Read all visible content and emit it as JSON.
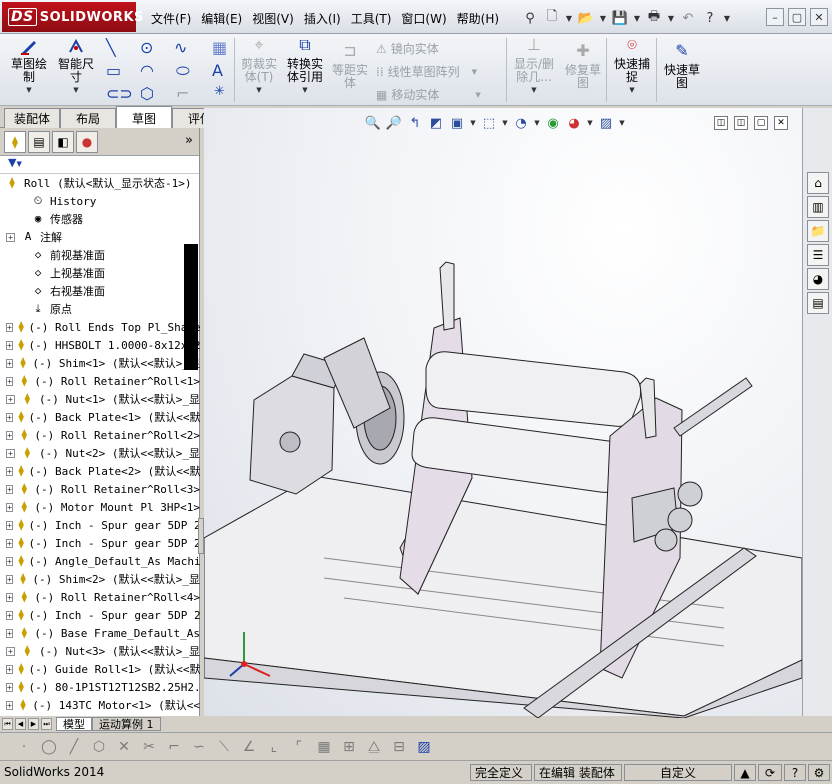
{
  "app": {
    "logo_prefix": "DS",
    "logo_text": "SOLIDWORKS"
  },
  "menu": [
    "文件(F)",
    "编辑(E)",
    "视图(V)",
    "插入(I)",
    "工具(T)",
    "窗口(W)",
    "帮助(H)"
  ],
  "ribbon": {
    "sketch": "草图绘\n制",
    "smart_dim": "智能尺\n寸",
    "trim": "剪裁实\n体(T)",
    "convert": "转换实\n体引用",
    "offset": "等距实\n体",
    "mirror": "镜向实体",
    "linear_pattern": "线性草图阵列",
    "move": "移动实体",
    "show_delete": "显示/删\n除几...",
    "repair": "修复草\n图",
    "quick_snap": "快速捕\n捉",
    "rapid_sketch": "快速草\n图"
  },
  "tabs": [
    "装配体",
    "布局",
    "草图",
    "评估"
  ],
  "active_tab": "草图",
  "tree": {
    "root": "Roll  (默认<默认_显示状态-1>)",
    "items": [
      {
        "label": "History",
        "icon": "history-icon",
        "expand": false
      },
      {
        "label": "传感器",
        "icon": "sensor-icon",
        "expand": false
      },
      {
        "label": "注解",
        "icon": "annotation-icon",
        "expand": true
      },
      {
        "label": "前视基准面",
        "icon": "plane-icon",
        "expand": false
      },
      {
        "label": "上视基准面",
        "icon": "plane-icon",
        "expand": false
      },
      {
        "label": "右视基准面",
        "icon": "plane-icon",
        "expand": false
      },
      {
        "label": "原点",
        "icon": "origin-icon",
        "expand": false
      },
      {
        "label": "(-) Roll Ends Top Pl_Shape",
        "icon": "part-icon",
        "expand": true
      },
      {
        "label": "(-) HHSBOLT 1.0000-8x12x12",
        "icon": "part-icon",
        "expand": true
      },
      {
        "label": "(-) Shim<1> (默认<<默认>_显",
        "icon": "part-icon",
        "expand": true
      },
      {
        "label": "(-) Roll Retainer^Roll<1>",
        "icon": "part-icon",
        "expand": true
      },
      {
        "label": "(-) Nut<1> (默认<<默认>_显",
        "icon": "part-icon",
        "expand": true
      },
      {
        "label": "(-) Back Plate<1> (默认<<默",
        "icon": "part-icon",
        "expand": true
      },
      {
        "label": "(-) Roll Retainer^Roll<2>",
        "icon": "part-icon",
        "expand": true
      },
      {
        "label": "(-) Nut<2> (默认<<默认>_显",
        "icon": "part-icon",
        "expand": true
      },
      {
        "label": "(-) Back Plate<2> (默认<<默",
        "icon": "part-icon",
        "expand": true
      },
      {
        "label": "(-) Roll Retainer^Roll<3>",
        "icon": "part-icon",
        "expand": true
      },
      {
        "label": "(-) Motor Mount Pl 3HP<1>",
        "icon": "part-icon",
        "expand": true
      },
      {
        "label": "(-) Inch - Spur gear 5DP 2",
        "icon": "part-icon",
        "expand": true
      },
      {
        "label": "(-) Inch - Spur gear 5DP 2",
        "icon": "part-icon",
        "expand": true
      },
      {
        "label": "(-) Angle_Default_As Machi",
        "icon": "part-icon",
        "expand": true
      },
      {
        "label": "(-) Shim<2> (默认<<默认>_显",
        "icon": "part-icon",
        "expand": true
      },
      {
        "label": "(-) Roll Retainer^Roll<4>",
        "icon": "part-icon",
        "expand": true
      },
      {
        "label": "(-) Inch - Spur gear 5DP 2",
        "icon": "part-icon",
        "expand": true
      },
      {
        "label": "(-) Base Frame_Default_As",
        "icon": "part-icon",
        "expand": true
      },
      {
        "label": "(-) Nut<3> (默认<<默认>_显",
        "icon": "part-icon",
        "expand": true
      },
      {
        "label": "(-) Guide Roll<1> (默认<<默",
        "icon": "part-icon",
        "expand": true
      },
      {
        "label": "(-) 80-1P1ST12T12SB2.25H2.",
        "icon": "part-icon",
        "expand": true
      },
      {
        "label": "(-) 143TC Motor<1> (默认<<",
        "icon": "part-icon",
        "expand": true
      }
    ]
  },
  "bottom_tabs": [
    "模型",
    "运动算例 1"
  ],
  "status": {
    "app": "SolidWorks 2014",
    "defined": "完全定义",
    "editing": "在编辑 装配体",
    "custom": "自定义"
  }
}
